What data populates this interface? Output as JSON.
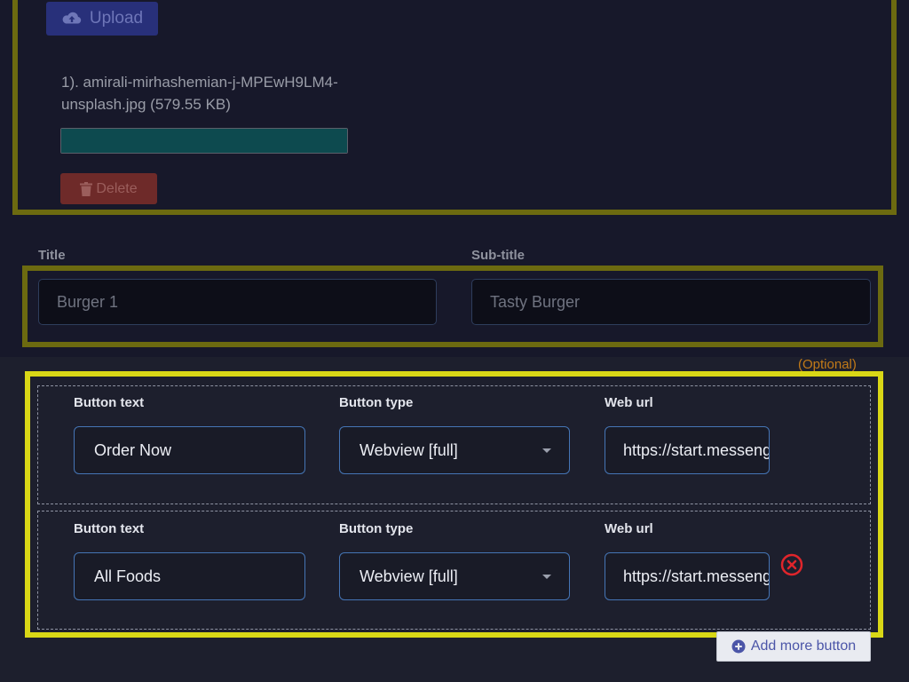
{
  "upload": {
    "button_label": "Upload",
    "file_label": "1). amirali-mirhashemian-j-MPEwH9LM4-unsplash.jpg (579.55 KB)",
    "progress_percent": 100,
    "delete_label": "Delete"
  },
  "title_field": {
    "label": "Title",
    "value": "Burger 1"
  },
  "subtitle_field": {
    "label": "Sub-title",
    "value": "Tasty Burger"
  },
  "buttons_section": {
    "optional_label": "(Optional)",
    "rows": [
      {
        "text_label": "Button text",
        "text_value": "Order Now",
        "type_label": "Button type",
        "type_value": "Webview [full]",
        "url_label": "Web url",
        "url_value": "https://start.messenger"
      },
      {
        "text_label": "Button text",
        "text_value": "All Foods",
        "type_label": "Button type",
        "type_value": "Webview [full]",
        "url_label": "Web url",
        "url_value": "https://start.messenger"
      }
    ],
    "add_more_label": "Add more button"
  },
  "colors": {
    "highlight_strong": "#d9d716",
    "highlight_dim": "#6c6a10",
    "input_border": "#4575b5",
    "remove_icon": "#e0252b",
    "optional_text": "#c27a18"
  }
}
